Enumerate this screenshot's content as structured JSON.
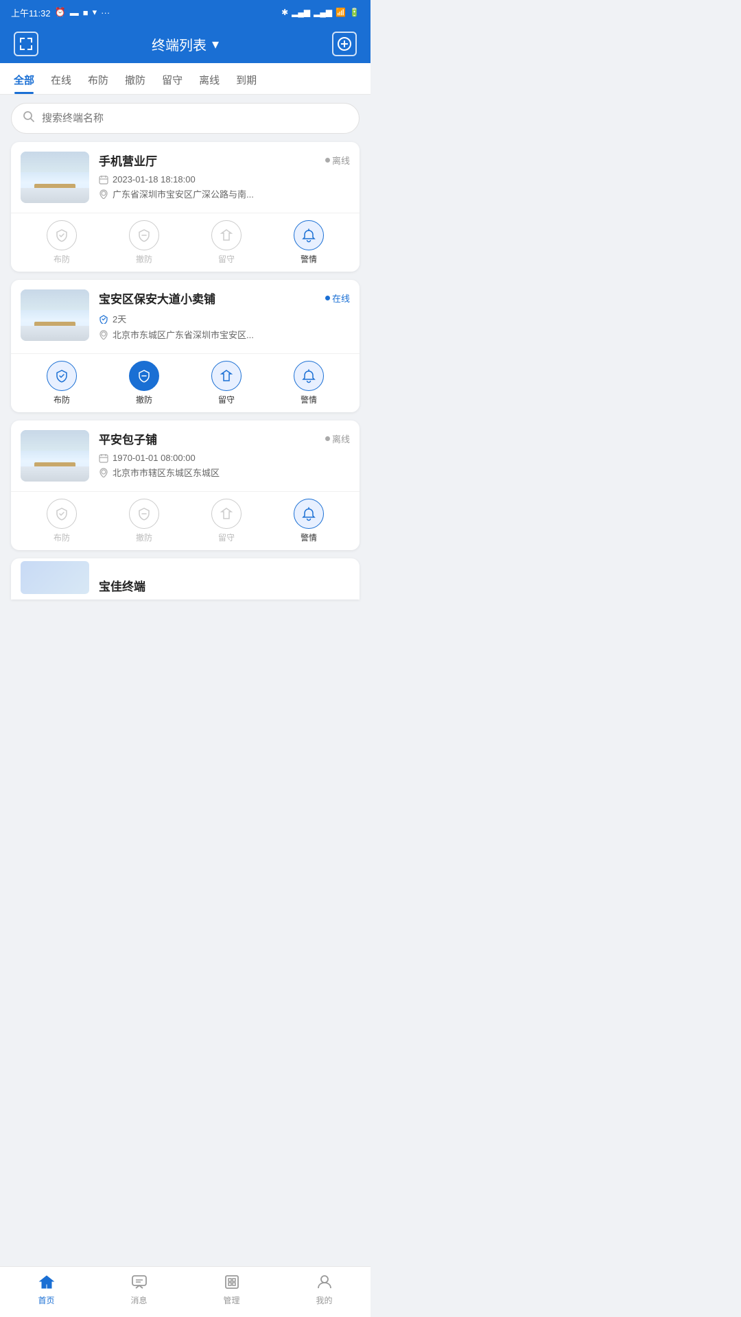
{
  "statusBar": {
    "time": "上午11:32",
    "icons": [
      "alarm",
      "sim1",
      "sim2",
      "wifi",
      "battery"
    ]
  },
  "header": {
    "title": "终端列表",
    "dropdownIcon": "▾",
    "leftIconLabel": "scan-icon",
    "rightIconLabel": "add-icon"
  },
  "tabs": [
    {
      "id": "all",
      "label": "全部",
      "active": true
    },
    {
      "id": "online",
      "label": "在线",
      "active": false
    },
    {
      "id": "armed",
      "label": "布防",
      "active": false
    },
    {
      "id": "disarmed",
      "label": "撤防",
      "active": false
    },
    {
      "id": "stay",
      "label": "留守",
      "active": false
    },
    {
      "id": "offline",
      "label": "离线",
      "active": false
    },
    {
      "id": "expired",
      "label": "到期",
      "active": false
    }
  ],
  "search": {
    "placeholder": "搜索终端名称"
  },
  "devices": [
    {
      "id": 1,
      "name": "手机营业厅",
      "status": "offline",
      "statusLabel": "离线",
      "datetime": "2023-01-18 18:18:00",
      "address": "广东省深圳市宝安区广深公路与南...",
      "actions": [
        {
          "id": "arm",
          "label": "布防",
          "active": false,
          "muted": true
        },
        {
          "id": "disarm",
          "label": "撤防",
          "active": false,
          "muted": true
        },
        {
          "id": "stay",
          "label": "留守",
          "active": false,
          "muted": true
        },
        {
          "id": "alarm",
          "label": "警情",
          "active": true,
          "muted": false
        }
      ]
    },
    {
      "id": 2,
      "name": "宝安区保安大道小卖铺",
      "status": "online",
      "statusLabel": "在线",
      "datetime": "2天",
      "address": "北京市东城区广东省深圳市宝安区...",
      "actions": [
        {
          "id": "arm",
          "label": "布防",
          "active": false,
          "muted": false,
          "circleActive": "light"
        },
        {
          "id": "disarm",
          "label": "撤防",
          "active": true,
          "muted": false,
          "circleActive": "blue"
        },
        {
          "id": "stay",
          "label": "留守",
          "active": false,
          "muted": false,
          "circleActive": "light"
        },
        {
          "id": "alarm",
          "label": "警情",
          "active": false,
          "muted": false,
          "circleActive": "light"
        }
      ]
    },
    {
      "id": 3,
      "name": "平安包子铺",
      "status": "offline",
      "statusLabel": "离线",
      "datetime": "1970-01-01 08:00:00",
      "address": "北京市市辖区东城区东城区",
      "actions": [
        {
          "id": "arm",
          "label": "布防",
          "active": false,
          "muted": true
        },
        {
          "id": "disarm",
          "label": "撤防",
          "active": false,
          "muted": true
        },
        {
          "id": "stay",
          "label": "留守",
          "active": false,
          "muted": true
        },
        {
          "id": "alarm",
          "label": "警情",
          "active": true,
          "muted": false
        }
      ]
    }
  ],
  "partialCard": {
    "name": "宝佳终端"
  },
  "bottomNav": [
    {
      "id": "home",
      "label": "首页",
      "active": true
    },
    {
      "id": "message",
      "label": "消息",
      "active": false
    },
    {
      "id": "manage",
      "label": "管理",
      "active": false
    },
    {
      "id": "profile",
      "label": "我的",
      "active": false
    }
  ]
}
